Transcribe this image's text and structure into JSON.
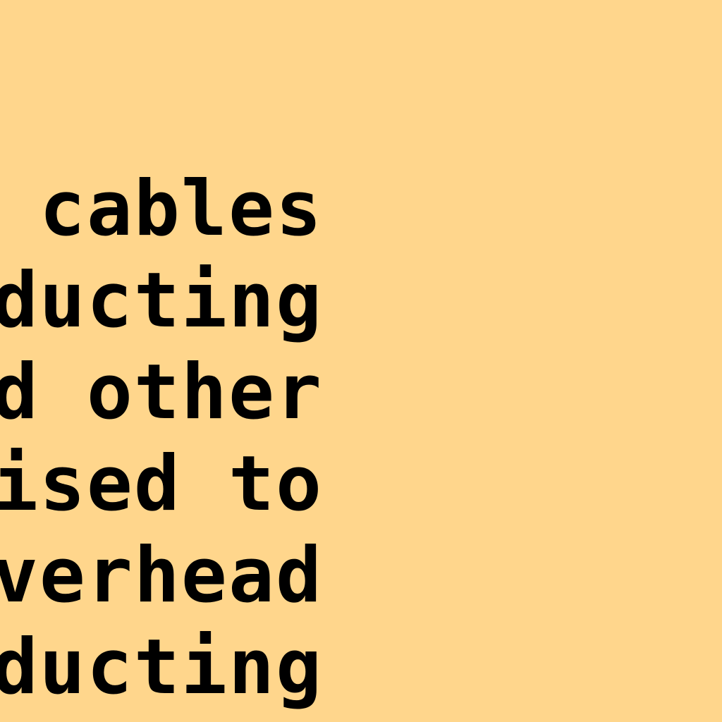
{
  "background_color": "#ffd68c",
  "text_color": "#000000",
  "lines": [
    " cables",
    "ducting",
    "d other",
    "ised to",
    "verhead",
    "ducting"
  ]
}
